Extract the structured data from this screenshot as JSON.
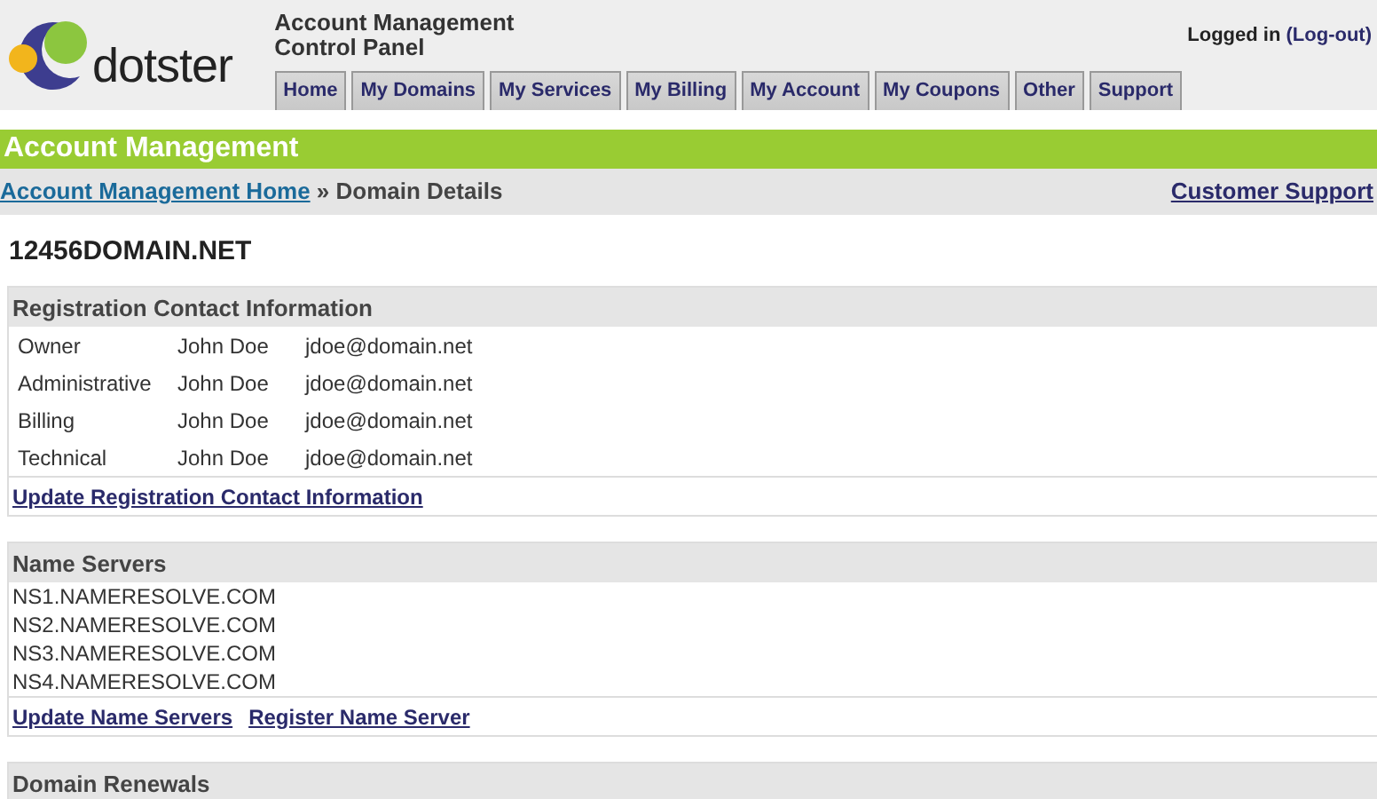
{
  "header": {
    "brand": "dotster",
    "title_lines": [
      "Account Management",
      "Control Panel"
    ],
    "login_text": "Logged in",
    "logout_link": "(Log-out)"
  },
  "tabs": [
    {
      "label": "Home",
      "selected": false
    },
    {
      "label": "My Domains",
      "selected": false
    },
    {
      "label": "My Services",
      "selected": false
    },
    {
      "label": "My Billing",
      "selected": false
    },
    {
      "label": "My Account",
      "selected": false
    },
    {
      "label": "My Coupons",
      "selected": false
    },
    {
      "label": "Other",
      "selected": false
    },
    {
      "label": "Support",
      "selected": false
    }
  ],
  "banner": "Account Management",
  "breadcrumb": {
    "home_link": "Account Management Home",
    "separator": "»",
    "current": "Domain Details",
    "support_link": "Customer Support"
  },
  "domain": "12456DOMAIN.NET",
  "sections": [
    {
      "kind": "contacts",
      "title": "Registration Contact Information",
      "rows": [
        {
          "role": "Owner",
          "name": "John Doe",
          "email": "jdoe@domain.net"
        },
        {
          "role": "Administrative",
          "name": "John Doe",
          "email": "jdoe@domain.net"
        },
        {
          "role": "Billing",
          "name": "John Doe",
          "email": "jdoe@domain.net"
        },
        {
          "role": "Technical",
          "name": "John Doe",
          "email": "jdoe@domain.net"
        }
      ],
      "links": [
        "Update Registration Contact Information"
      ]
    },
    {
      "kind": "servers",
      "title": "Name Servers",
      "lines": [
        "NS1.NAMERESOLVE.COM",
        "NS2.NAMERESOLVE.COM",
        "NS3.NAMERESOLVE.COM",
        "NS4.NAMERESOLVE.COM"
      ],
      "links": [
        "Update Name Servers",
        "Register Name Server"
      ]
    },
    {
      "kind": "heading",
      "title": "Domain Renewals"
    }
  ]
}
